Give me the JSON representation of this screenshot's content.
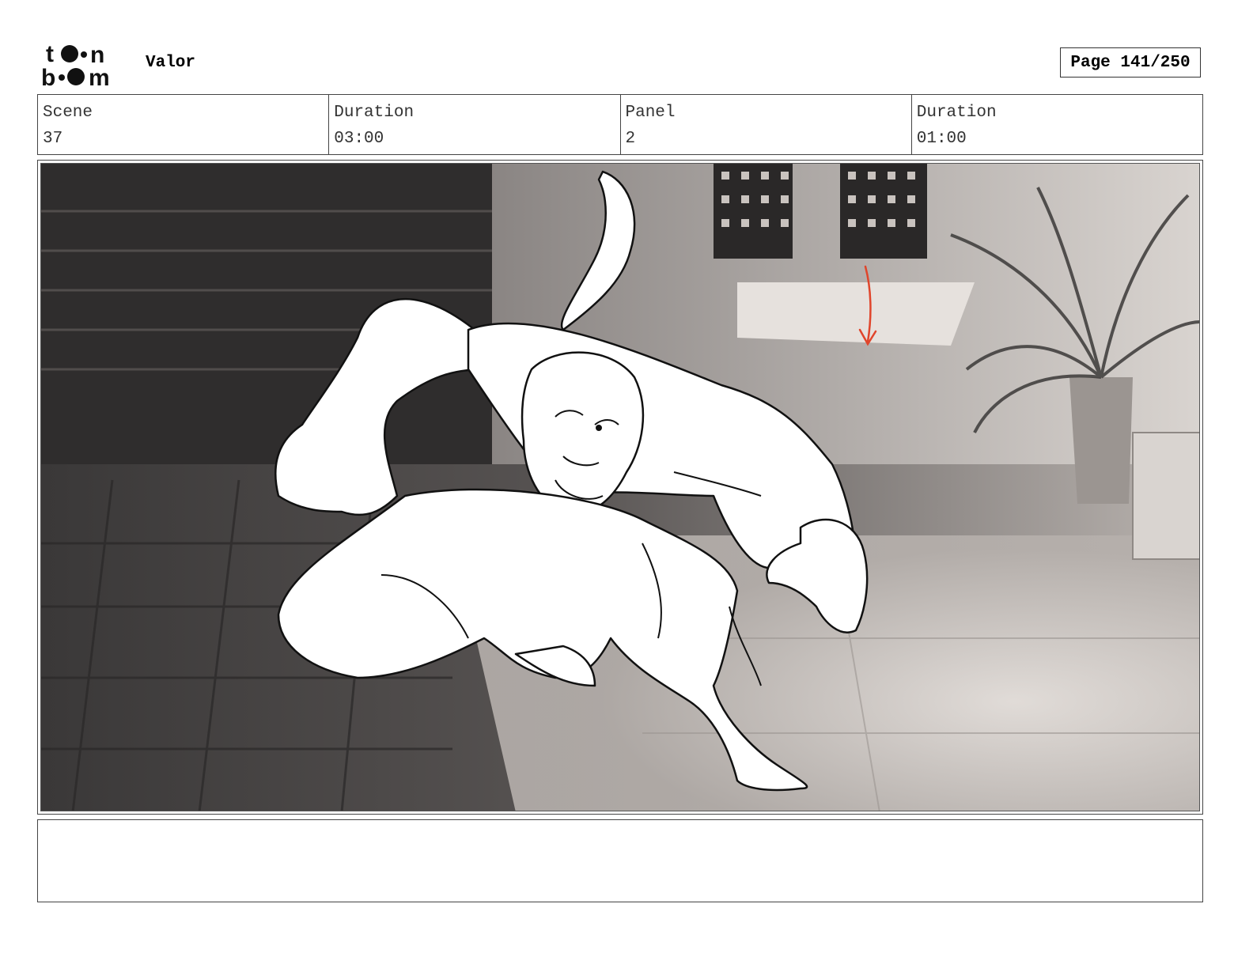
{
  "header": {
    "logo_alt": "toon boom",
    "project_title": "Valor",
    "page_label": "Page 141/250"
  },
  "info": {
    "scene_label": "Scene",
    "scene_value": "37",
    "scene_duration_label": "Duration",
    "scene_duration_value": "03:00",
    "panel_label": "Panel",
    "panel_value": "2",
    "panel_duration_label": "Duration",
    "panel_duration_value": "01:00"
  },
  "panel": {
    "image_description_icon": "storyboard-frame",
    "annotation_color": "#e0452b"
  },
  "notes": {
    "text": ""
  }
}
